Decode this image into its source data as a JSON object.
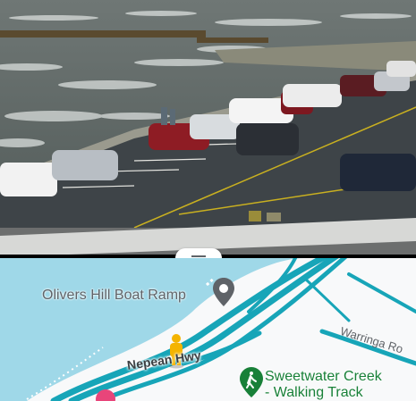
{
  "photo": {
    "description_icon": "camera-feed-icon"
  },
  "map": {
    "places": {
      "boat_ramp": "Olivers Hill Boat Ramp",
      "walking_track_line1": "Sweetwater Creek",
      "walking_track_line2": "- Walking Track"
    },
    "roads": {
      "main": "Nepean Hwy",
      "side": "Warringa Ro"
    },
    "colors": {
      "water": "#9fd8e8",
      "land": "#f8f9fa",
      "road": "#17a5b8",
      "park": "#188038",
      "pin": "#5f6368",
      "pegman": "#f4b400"
    }
  },
  "handle": {
    "icon": "drag-handle-icon"
  }
}
